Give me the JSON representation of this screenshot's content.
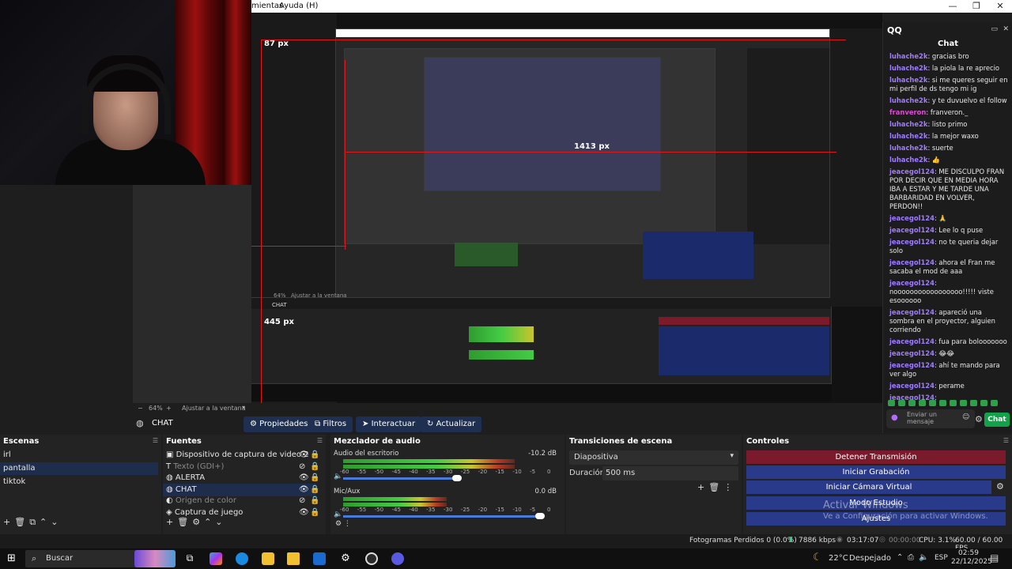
{
  "menubar": {
    "items": [
      "mientas",
      "Ayuda (H)"
    ]
  },
  "window_controls": [
    "—",
    "❐",
    "✕"
  ],
  "preview": {
    "labels": [
      "87 px",
      "1413 px",
      "445 px"
    ],
    "nested_zoom": "64%",
    "nested_fit": "Ajustar a la ventana",
    "nested_scene": "CHAT"
  },
  "chat_dock": {
    "panel_title": "QQ",
    "title": "Chat",
    "messages": [
      {
        "user": "luhache2k",
        "text": ": gracias bro"
      },
      {
        "user": "luhache2k",
        "text": ": la piola la re aprecio"
      },
      {
        "user": "luhache2k",
        "text": ": si me queres seguir en mi perfil de ds tengo mi ig"
      },
      {
        "user": "luhache2k",
        "text": ": y te duvuelvo el follow"
      },
      {
        "user": "franveron",
        "text": ": franveron._"
      },
      {
        "user": "luhache2k",
        "text": ": listo primo"
      },
      {
        "user": "luhache2k",
        "text": ": la mejor waxo"
      },
      {
        "user": "luhache2k",
        "text": ": suerte"
      },
      {
        "user": "luhache2k",
        "text": ": 👍"
      },
      {
        "user": "jeacegol124",
        "text": ": ME DISCULPO FRAN POR DECIR QUE EN MEDIA HORA IBA A ESTAR Y ME TARDE UNA BARBARIDAD EN VOLVER, PERDON!!"
      },
      {
        "user": "jeacegol124",
        "text": ": 🙏"
      },
      {
        "user": "jeacegol124",
        "text": ": Lee lo q puse"
      },
      {
        "user": "jeacegol124",
        "text": ": no te queria dejar solo"
      },
      {
        "user": "jeacegol124",
        "text": ": ahora el Fran me sacaba el mod de aaa"
      },
      {
        "user": "jeacegol124",
        "text": ": nooooooooooooooooo!!!!! viste esoooooo"
      },
      {
        "user": "jeacegol124",
        "text": ": apareció una sombra en el proyector, alguien corriendo"
      },
      {
        "user": "jeacegol124",
        "text": ": fua para bolooooooo"
      },
      {
        "user": "jeacegol124",
        "text": ": 😂😂"
      },
      {
        "user": "jeacegol124",
        "text": ": ahí te mando para ver algo"
      },
      {
        "user": "jeacegol124",
        "text": ": perame"
      },
      {
        "user": "jeacegol124",
        "text": ":"
      }
    ],
    "input_placeholder": "Enviar un mensaje",
    "send_label": "Chat"
  },
  "zoombar": {
    "zoom": "64%",
    "fit_label": "Ajustar a la ventana"
  },
  "source_toolbar": {
    "source_name": "CHAT",
    "properties": "Propiedades",
    "filters": "Filtros",
    "interact": "Interactuar",
    "refresh": "Actualizar"
  },
  "scenes": {
    "title": "Escenas",
    "items": [
      "irl",
      "pantalla",
      "tiktok"
    ],
    "selected": "pantalla"
  },
  "sources": {
    "title": "Fuentes",
    "items": [
      {
        "label": "Dispositivo de captura de video 2",
        "icon": "camera-icon",
        "visible": true
      },
      {
        "label": "Texto (GDI+)",
        "icon": "text-icon",
        "visible": false
      },
      {
        "label": "ALERTA",
        "icon": "globe-icon",
        "visible": true
      },
      {
        "label": "CHAT",
        "icon": "globe-icon",
        "visible": true
      },
      {
        "label": "Origen de color",
        "icon": "palette-icon",
        "visible": false
      },
      {
        "label": "Captura de juego",
        "icon": "gamepad-icon",
        "visible": true
      }
    ],
    "selected": "CHAT"
  },
  "mixer": {
    "title": "Mezclador de audio",
    "channels": [
      {
        "name": "Audio del escritorio",
        "db": "-10.2 dB",
        "level": 0.83,
        "volume": 0.55
      },
      {
        "name": "Mic/Aux",
        "db": "0.0 dB",
        "level": 0.5,
        "volume": 0.95
      }
    ],
    "ticks": [
      "-60",
      "-55",
      "-50",
      "-45",
      "-40",
      "-35",
      "-30",
      "-25",
      "-20",
      "-15",
      "-10",
      "-5",
      "0"
    ]
  },
  "transitions": {
    "title": "Transiciones de escena",
    "selected": "Diapositiva",
    "duration_label": "Duración",
    "duration_value": "500 ms"
  },
  "controls": {
    "title": "Controles",
    "buttons": [
      "Detener Transmisión",
      "Iniciar Grabación",
      "Iniciar Cámara Virtual",
      "Modo Estudio",
      "Ajustes"
    ],
    "activation_title": "Activar Windows",
    "activation_sub": "Ve a Configuración para activar Windows."
  },
  "status": {
    "dropped": "Fotogramas Perdidos 0 (0.0%)",
    "kbps": "7886 kbps",
    "stream_time": "03:17:07",
    "rec_time": "00:00:00",
    "cpu": "CPU: 3.1%",
    "fps": "60.00 / 60.00 FPS"
  },
  "taskbar": {
    "search_placeholder": "Buscar",
    "weather_temp": "22°C",
    "weather_text": "Despejado",
    "lang": "ESP",
    "time": "02:59",
    "date": "22/12/2025"
  },
  "colors": {
    "accent_red": "#e0161b",
    "control_blue": "#2a3a8a",
    "stop_red": "#7a1a2a",
    "chat_green": "#11a24a"
  }
}
